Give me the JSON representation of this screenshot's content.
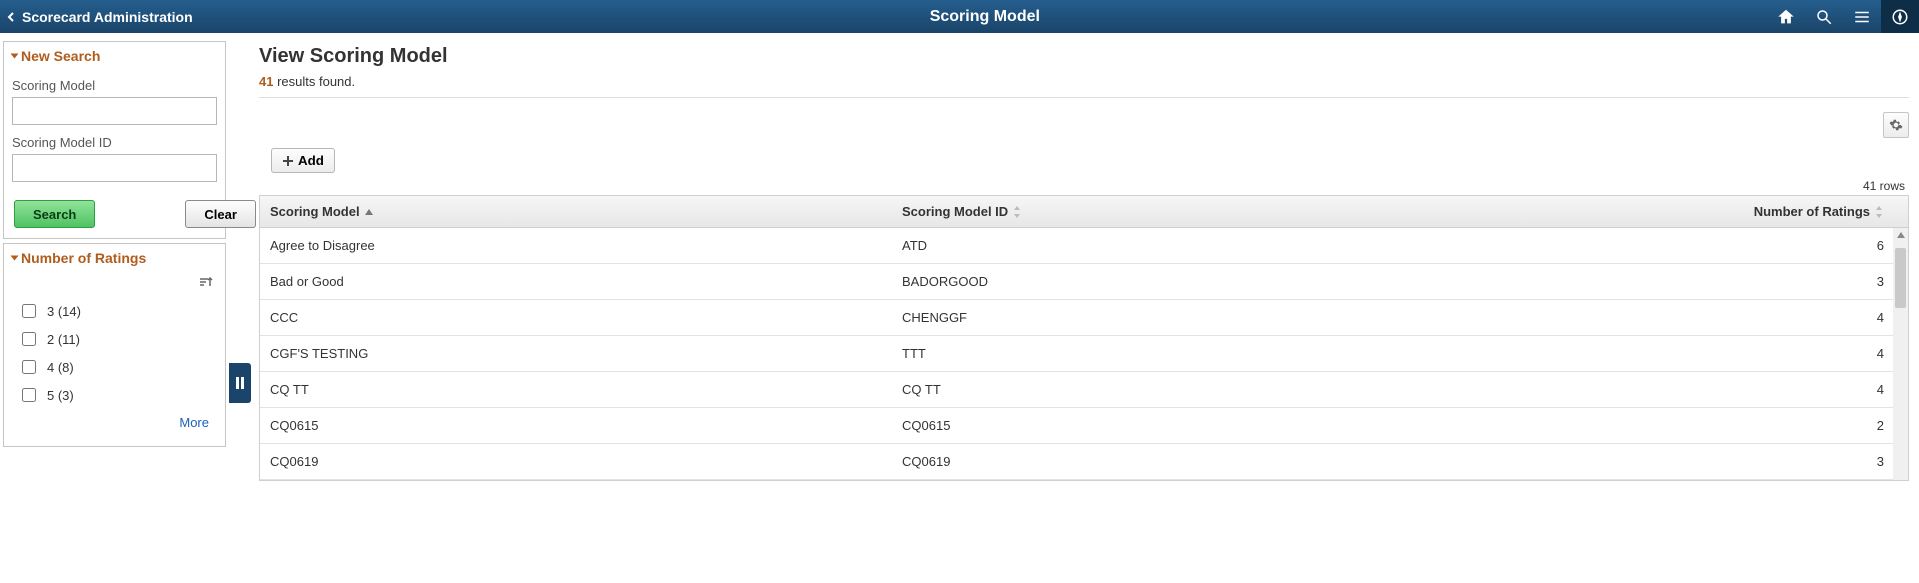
{
  "topbar": {
    "breadcrumb": "Scorecard Administration",
    "title": "Scoring Model"
  },
  "sidebar": {
    "new_search": {
      "title": "New Search",
      "scoring_model_label": "Scoring Model",
      "scoring_model_value": "",
      "scoring_model_id_label": "Scoring Model ID",
      "scoring_model_id_value": "",
      "search_btn": "Search",
      "clear_btn": "Clear"
    },
    "ratings": {
      "title": "Number of Ratings",
      "items": [
        {
          "label": "3 (14)",
          "checked": false
        },
        {
          "label": "2 (11)",
          "checked": false
        },
        {
          "label": "4 (8)",
          "checked": false
        },
        {
          "label": "5 (3)",
          "checked": false
        }
      ],
      "more_label": "More"
    }
  },
  "main": {
    "page_title": "View Scoring Model",
    "results_count": "41",
    "results_suffix": " results found.",
    "add_label": "Add",
    "row_count_label": "41 rows",
    "columns": {
      "model": "Scoring Model",
      "id": "Scoring Model ID",
      "num": "Number of Ratings"
    },
    "rows": [
      {
        "model": "Agree to Disagree",
        "id": "ATD",
        "num": "6"
      },
      {
        "model": "Bad or Good",
        "id": "BADORGOOD",
        "num": "3"
      },
      {
        "model": "CCC",
        "id": "CHENGGF",
        "num": "4"
      },
      {
        "model": "CGF'S TESTING",
        "id": "TTT",
        "num": "4"
      },
      {
        "model": "CQ  TT",
        "id": "CQ  TT",
        "num": "4"
      },
      {
        "model": "CQ0615",
        "id": "CQ0615",
        "num": "2"
      },
      {
        "model": "CQ0619",
        "id": "CQ0619",
        "num": "3"
      }
    ]
  },
  "icons": {
    "home": "home-icon",
    "search": "search-icon",
    "menu": "menu-icon",
    "compass": "compass-icon",
    "gear": "gear-icon",
    "plus": "plus-icon",
    "chevron_left": "chevron-left-icon",
    "pause": "pause-icon",
    "sort_toggle": "sort-toggle-icon"
  }
}
